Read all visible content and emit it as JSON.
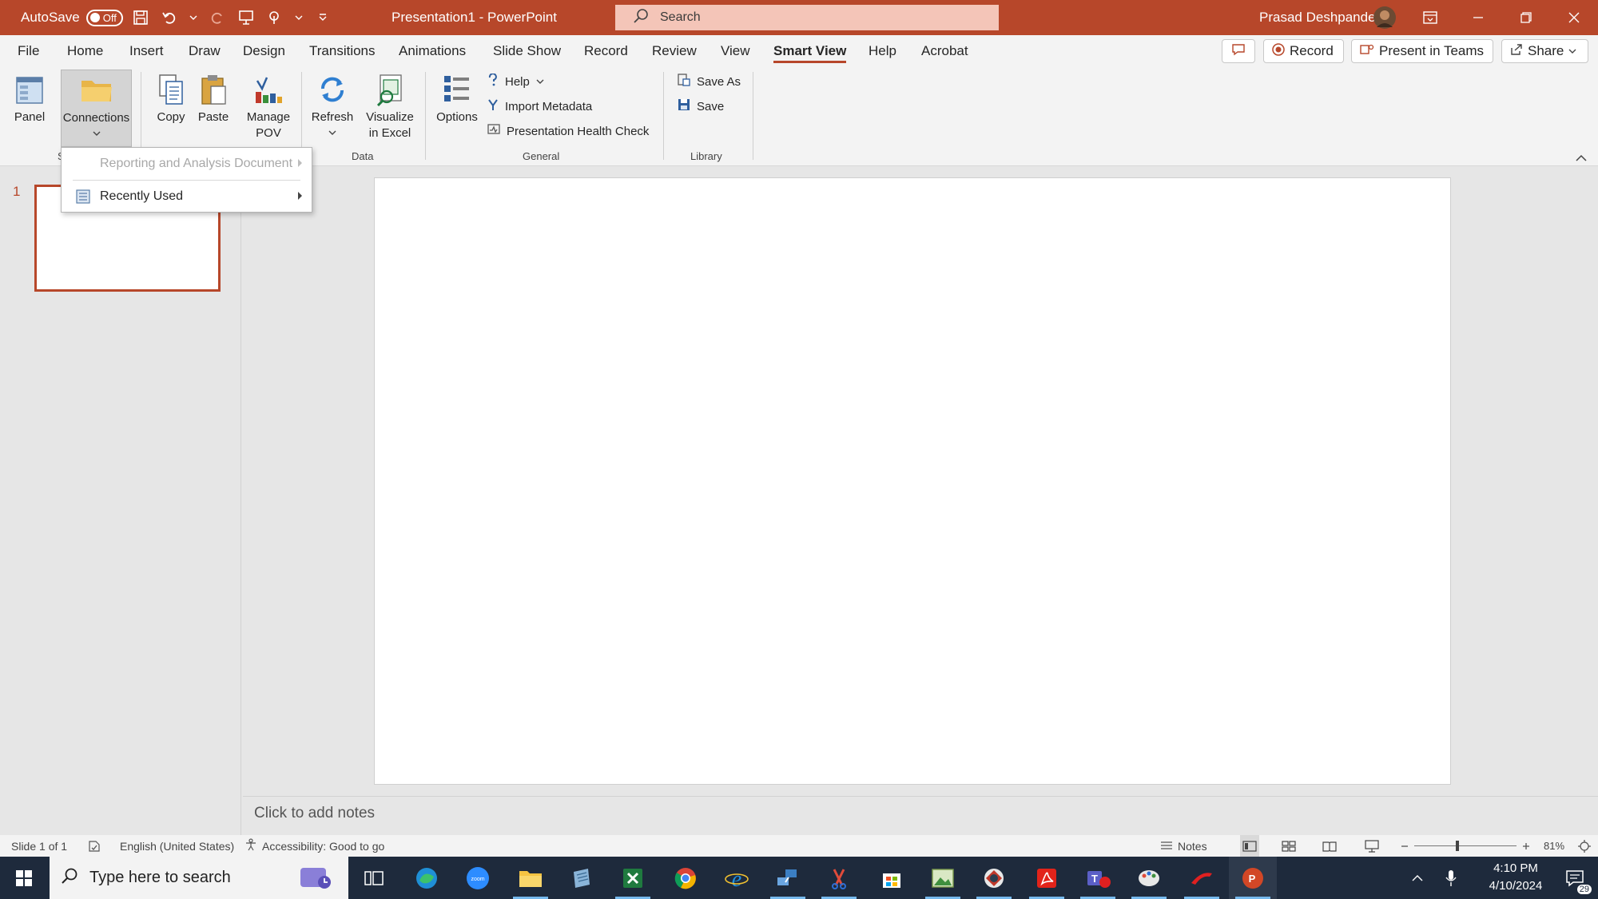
{
  "window": {
    "autosave_label": "AutoSave",
    "autosave_state": "Off",
    "doc_title": "Presentation1 - PowerPoint",
    "search_placeholder": "Search",
    "user_name": "Prasad Deshpande"
  },
  "tabs": [
    "File",
    "Home",
    "Insert",
    "Draw",
    "Design",
    "Transitions",
    "Animations",
    "Slide Show",
    "Record",
    "Review",
    "View",
    "Smart View",
    "Help",
    "Acrobat"
  ],
  "active_tab": "Smart View",
  "header_actions": {
    "record": "Record",
    "present_in_teams": "Present in Teams",
    "share": "Share"
  },
  "ribbon": {
    "panel": "Panel",
    "connections": "Connections",
    "copy": "Copy",
    "paste": "Paste",
    "manage_pov_l1": "Manage",
    "manage_pov_l2": "POV",
    "refresh": "Refresh",
    "visualize_l1": "Visualize",
    "visualize_l2": "in Excel",
    "options": "Options",
    "help": "Help",
    "import_metadata": "Import Metadata",
    "presentation_health_check": "Presentation Health Check",
    "save_as": "Save As",
    "save": "Save",
    "groups": {
      "first_partial": "S",
      "data": "Data",
      "general": "General",
      "library": "Library"
    }
  },
  "connections_menu": {
    "items": [
      {
        "label": "Reporting and Analysis Document",
        "enabled": false
      },
      {
        "label": "Recently Used",
        "enabled": true
      }
    ]
  },
  "thumbnail": {
    "slide_number": "1"
  },
  "notes_placeholder": "Click to add notes",
  "status": {
    "slide": "Slide 1 of 1",
    "language": "English (United States)",
    "accessibility": "Accessibility: Good to go",
    "notes": "Notes",
    "zoom": "81%"
  },
  "taskbar": {
    "search_placeholder": "Type here to search",
    "time": "4:10 PM",
    "date": "4/10/2024",
    "notifications": "29"
  },
  "colors": {
    "accent": "#b7472a",
    "taskbar": "#1e2a3c"
  }
}
